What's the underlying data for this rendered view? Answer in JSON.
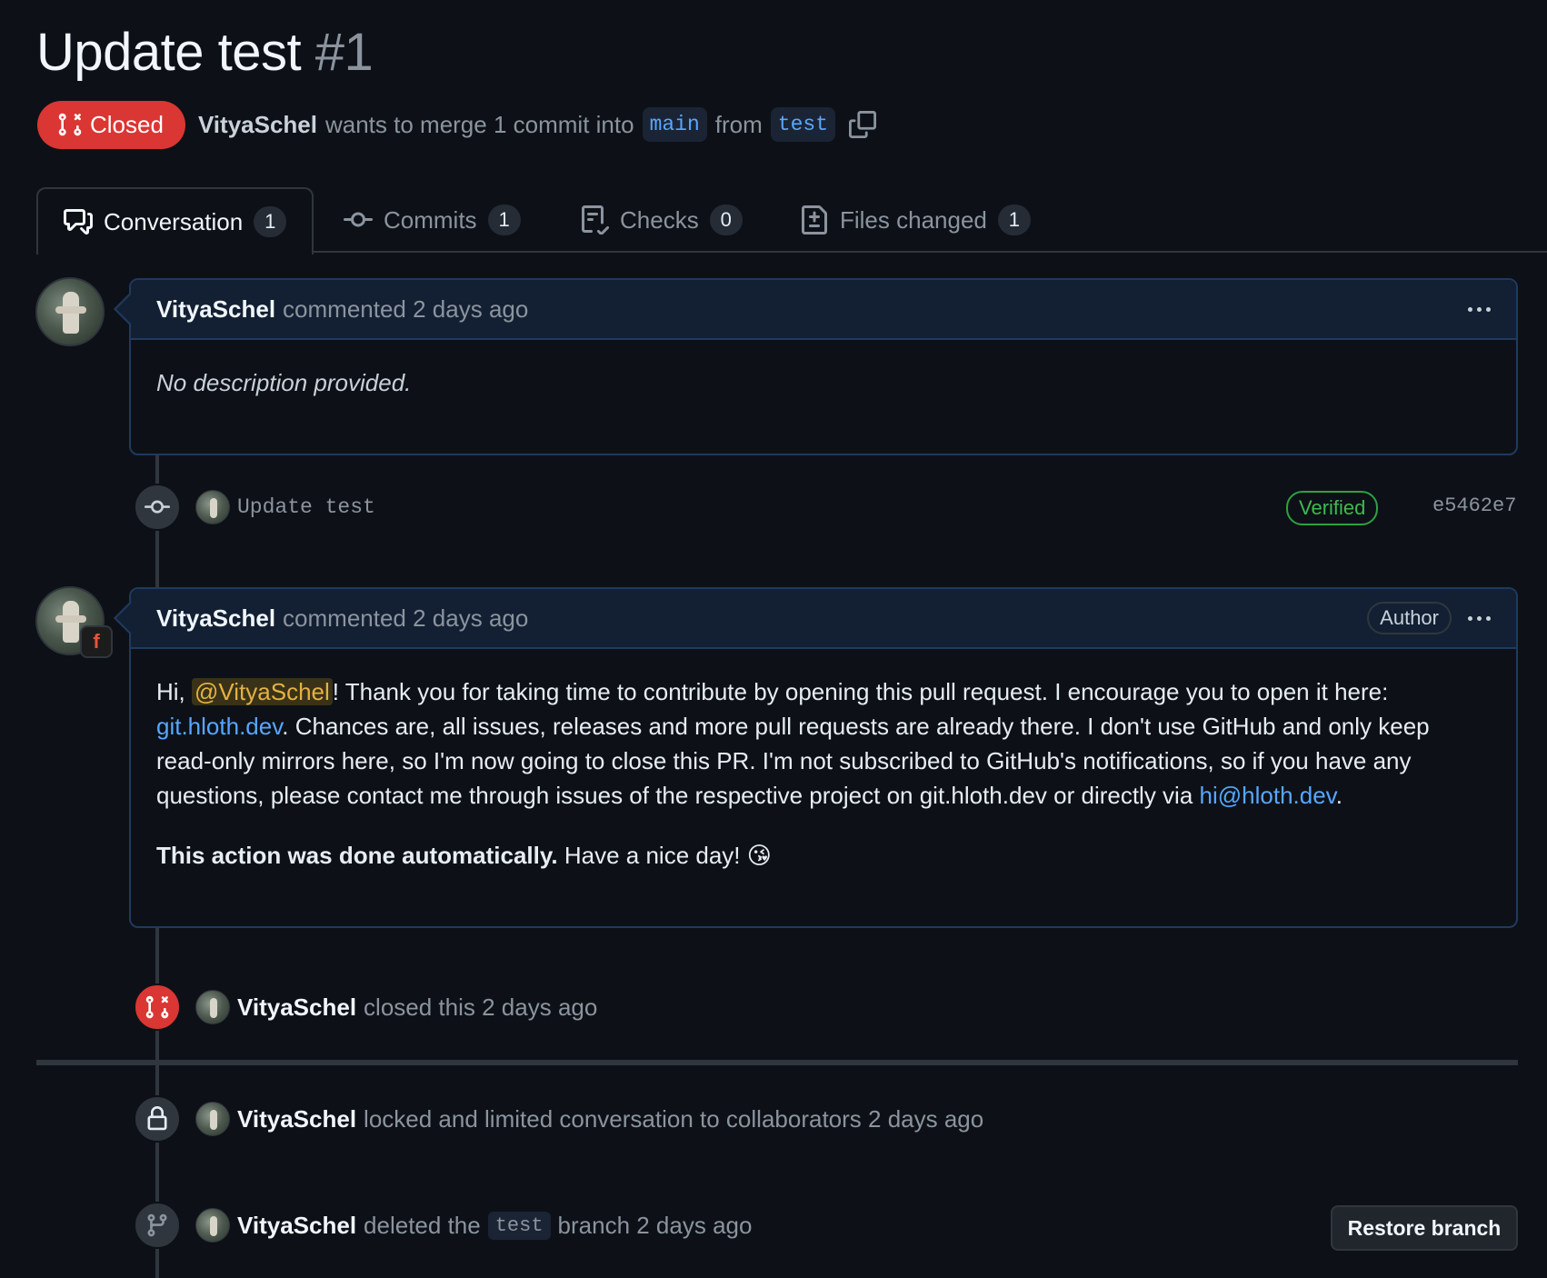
{
  "pr": {
    "title": "Update test",
    "number": "#1",
    "state": "Closed",
    "author": "VityaSchel",
    "summary_mid": "wants to merge 1 commit into",
    "base_branch": "main",
    "from_word": "from",
    "head_branch": "test"
  },
  "tabs": [
    {
      "label": "Conversation",
      "count": "1",
      "icon": "comment-discussion-icon"
    },
    {
      "label": "Commits",
      "count": "1",
      "icon": "git-commit-icon"
    },
    {
      "label": "Checks",
      "count": "0",
      "icon": "checklist-icon"
    },
    {
      "label": "Files changed",
      "count": "1",
      "icon": "file-diff-icon"
    }
  ],
  "comment1": {
    "user": "VityaSchel",
    "meta": "commented 2 days ago",
    "body": "No description provided."
  },
  "commit": {
    "message": "Update test",
    "verified": "Verified",
    "sha": "e5462e7"
  },
  "comment2": {
    "user": "VityaSchel",
    "meta": "commented 2 days ago",
    "author_badge": "Author",
    "app_badge": "f",
    "p1_start": "Hi, ",
    "mention": "@VityaSchel",
    "p1_a": "! Thank you for taking time to contribute by opening this pull request. I encourage you to open it here: ",
    "link1": "git.hloth.dev",
    "p1_b": ". Chances are, all issues, releases and more pull requests are already there. I don't use GitHub and only keep read-only mirrors here, so I'm now going to close this PR. I'm not subscribed to GitHub's notifications, so if you have any questions, please contact me through issues of the respective project on git.hloth.dev or directly via ",
    "link2": "hi@hloth.dev",
    "p1_end": ".",
    "p2_bold": "This action was done automatically.",
    "p2_rest": " Have a nice day! 😘"
  },
  "events": {
    "closed": {
      "user": "VityaSchel",
      "text": "closed this 2 days ago"
    },
    "locked": {
      "user": "VityaSchel",
      "text": "locked and limited conversation to collaborators 2 days ago"
    },
    "deleted": {
      "user": "VityaSchel",
      "text_a": "deleted the",
      "branch": "test",
      "text_b": "branch 2 days ago",
      "button": "Restore branch"
    }
  },
  "colors": {
    "closed_red": "#da3633",
    "link_blue": "#58a6ff",
    "verified_green": "#3fb950"
  }
}
